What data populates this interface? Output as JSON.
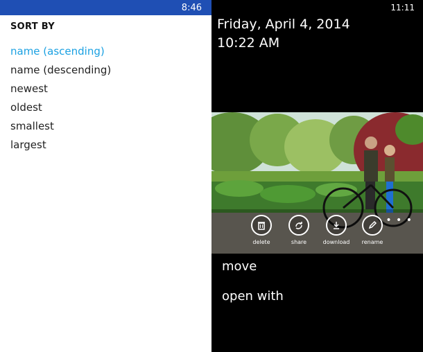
{
  "left_screen": {
    "status_time": "8:46",
    "sort_title": "SORT BY",
    "sort_options": [
      {
        "label": "name (ascending)",
        "selected": true
      },
      {
        "label": "name (descending)",
        "selected": false
      },
      {
        "label": "newest",
        "selected": false
      },
      {
        "label": "oldest",
        "selected": false
      },
      {
        "label": "smallest",
        "selected": false
      },
      {
        "label": "largest",
        "selected": false
      }
    ],
    "accent_color": "#1ba1e2",
    "status_bar_color": "#1f4fb4"
  },
  "right_screen": {
    "status_time": "11:11",
    "date": "Friday, April 4, 2014",
    "time": "10:22 AM",
    "app_bar": [
      {
        "label": "delete",
        "icon": "trash-icon"
      },
      {
        "label": "share",
        "icon": "share-icon"
      },
      {
        "label": "download",
        "icon": "download-icon"
      },
      {
        "label": "rename",
        "icon": "pencil-icon"
      }
    ],
    "more_label": "• • •",
    "menu_items": [
      "move",
      "open with"
    ]
  }
}
